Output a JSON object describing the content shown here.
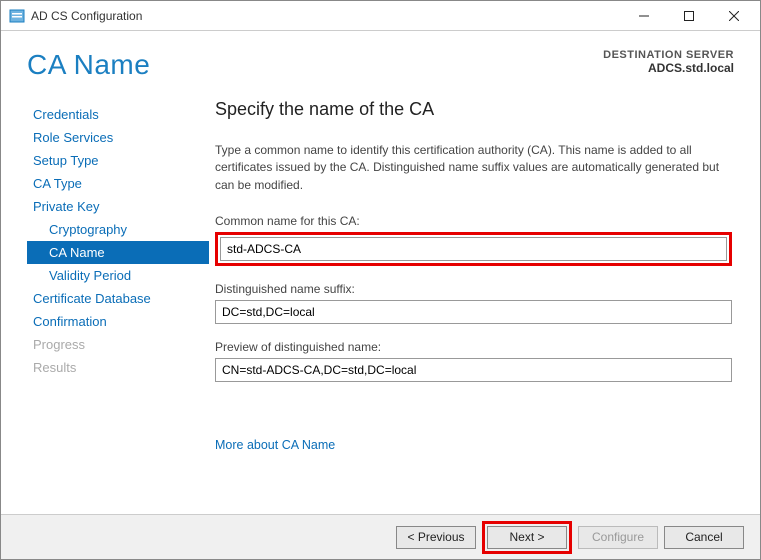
{
  "titlebar": {
    "title": "AD CS Configuration"
  },
  "header": {
    "title": "CA Name",
    "dest_label": "DESTINATION SERVER",
    "dest_server": "ADCS.std.local"
  },
  "sidebar": {
    "items": [
      {
        "label": "Credentials",
        "sub": false
      },
      {
        "label": "Role Services",
        "sub": false
      },
      {
        "label": "Setup Type",
        "sub": false
      },
      {
        "label": "CA Type",
        "sub": false
      },
      {
        "label": "Private Key",
        "sub": false
      },
      {
        "label": "Cryptography",
        "sub": true
      },
      {
        "label": "CA Name",
        "sub": true,
        "active": true
      },
      {
        "label": "Validity Period",
        "sub": true
      },
      {
        "label": "Certificate Database",
        "sub": false
      },
      {
        "label": "Confirmation",
        "sub": false
      },
      {
        "label": "Progress",
        "sub": false,
        "disabled": true
      },
      {
        "label": "Results",
        "sub": false,
        "disabled": true
      }
    ]
  },
  "main": {
    "heading": "Specify the name of the CA",
    "description": "Type a common name to identify this certification authority (CA). This name is added to all certificates issued by the CA. Distinguished name suffix values are automatically generated but can be modified.",
    "common_name_label": "Common name for this CA:",
    "common_name_value": "std-ADCS-CA",
    "dn_suffix_label": "Distinguished name suffix:",
    "dn_suffix_value": "DC=std,DC=local",
    "preview_label": "Preview of distinguished name:",
    "preview_value": "CN=std-ADCS-CA,DC=std,DC=local",
    "more_link": "More about CA Name"
  },
  "footer": {
    "previous": "< Previous",
    "next": "Next >",
    "configure": "Configure",
    "cancel": "Cancel"
  }
}
